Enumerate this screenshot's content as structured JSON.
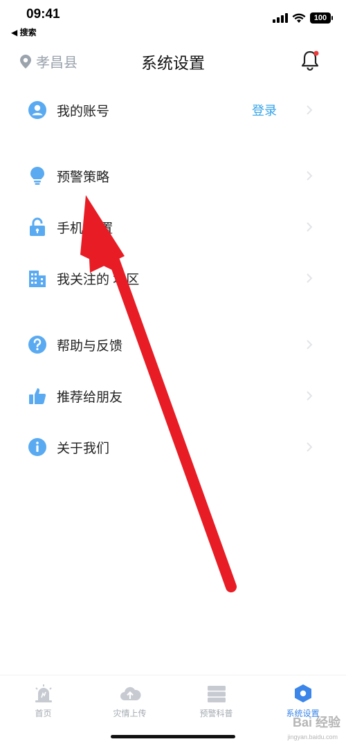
{
  "status_bar": {
    "time": "09:41",
    "back_app": "◀ 搜索",
    "battery": "100"
  },
  "nav": {
    "location": "孝昌县",
    "title": "系统设置"
  },
  "menu": {
    "items": [
      {
        "label": "我的账号",
        "extra": "登录",
        "icon": "user-icon"
      },
      {
        "label": "预警策略",
        "icon": "lightbulb-icon"
      },
      {
        "label": "手机     设置",
        "icon": "lock-icon"
      },
      {
        "label": "我关注的 地区",
        "icon": "building-icon"
      },
      {
        "label": "帮助与反馈",
        "icon": "question-icon"
      },
      {
        "label": "推荐给朋友",
        "icon": "thumbs-up-icon"
      },
      {
        "label": "关于我们",
        "icon": "info-icon"
      }
    ]
  },
  "tabs": [
    {
      "label": "首页",
      "icon": "alarm-icon"
    },
    {
      "label": "灾情上传",
      "icon": "cloud-upload-icon"
    },
    {
      "label": "预警科普",
      "icon": "book-icon"
    },
    {
      "label": "系统设置",
      "icon": "settings-hex-icon",
      "active": true
    }
  ],
  "watermark": {
    "text": "Bai 经验",
    "sub": "jingyan.baidu.com"
  },
  "colors": {
    "accent": "#35a3e8",
    "icon_blue": "#5aaaf2",
    "arrow": "#e81c24",
    "tab_inactive": "#c7cbd1"
  }
}
